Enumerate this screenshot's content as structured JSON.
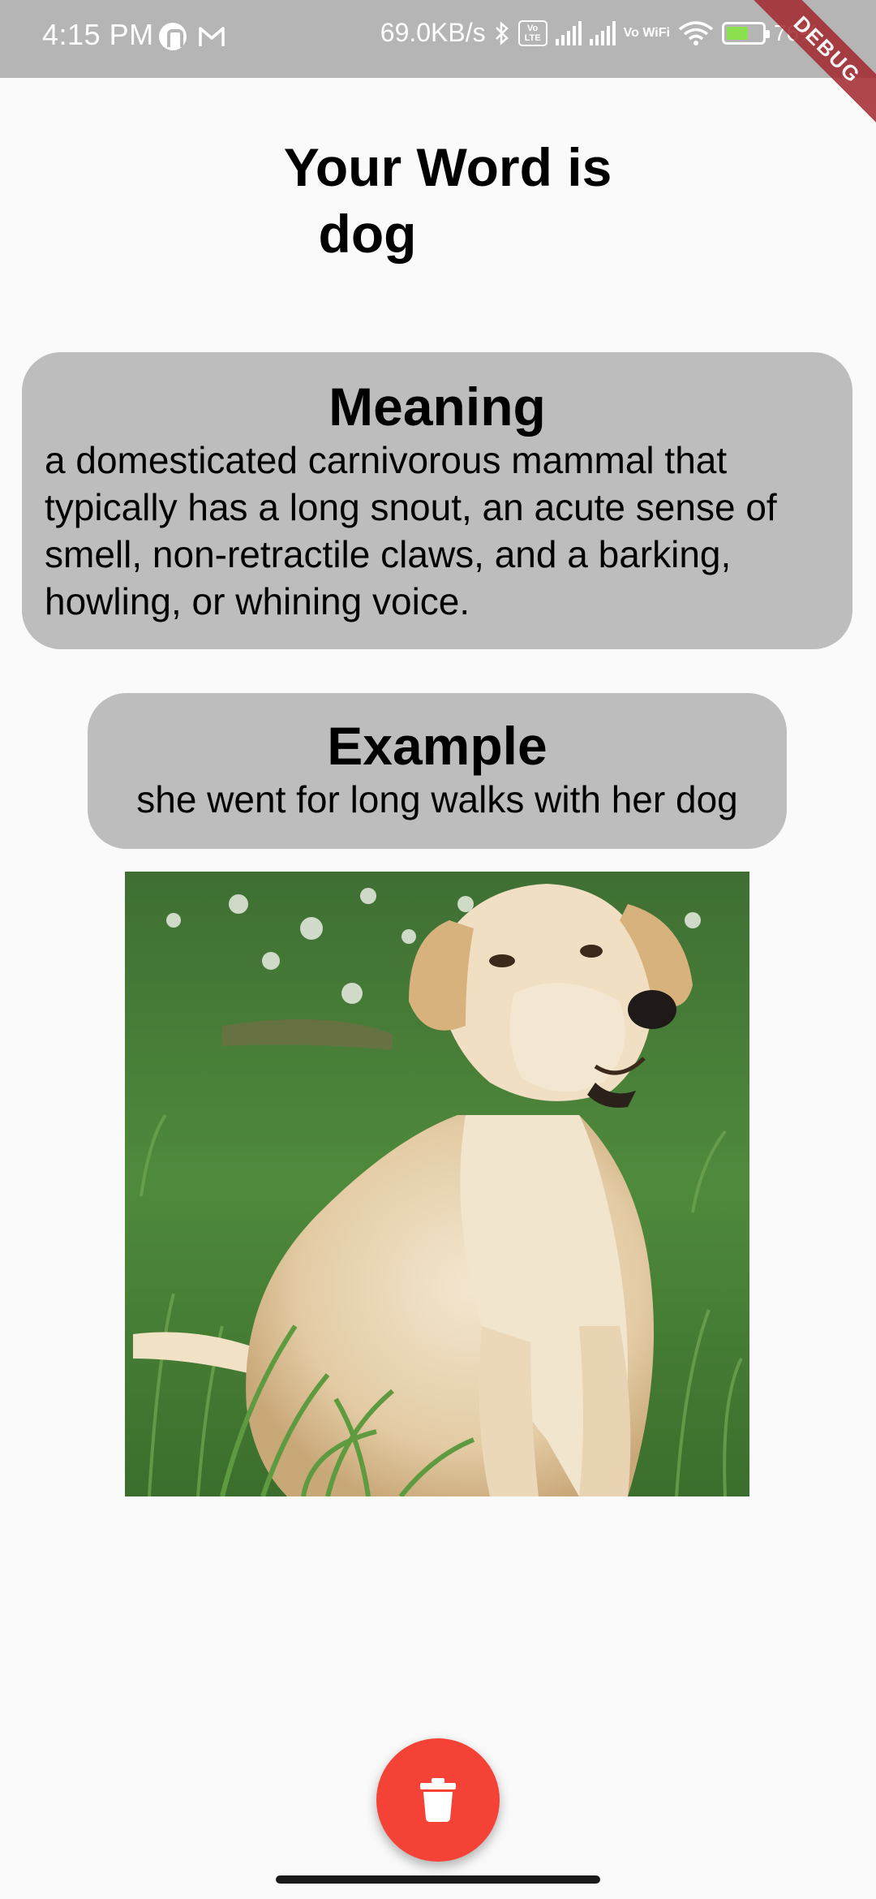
{
  "status_bar": {
    "time": "4:15 PM",
    "net_speed": "69.0KB/s",
    "volte_label": "Vo LTE",
    "vowifi_label": "Vo WiFi",
    "battery": "76%"
  },
  "debug_banner": "DEBUG",
  "header": {
    "title_line1": "Your Word is",
    "word": "dog"
  },
  "meaning": {
    "title": "Meaning",
    "text": "a domesticated carnivorous mammal that typically has a long snout, an acute sense of smell, non-retractile claws, and a barking, howling, or whining voice."
  },
  "example": {
    "title": "Example",
    "text": "she went for long walks with her dog"
  },
  "fab": {
    "icon": "trash-icon",
    "color": "#f44336"
  },
  "colors": {
    "card_background": "#bdbdbd",
    "page_background": "#fafafa",
    "status_bar": "#b5b5b5"
  }
}
